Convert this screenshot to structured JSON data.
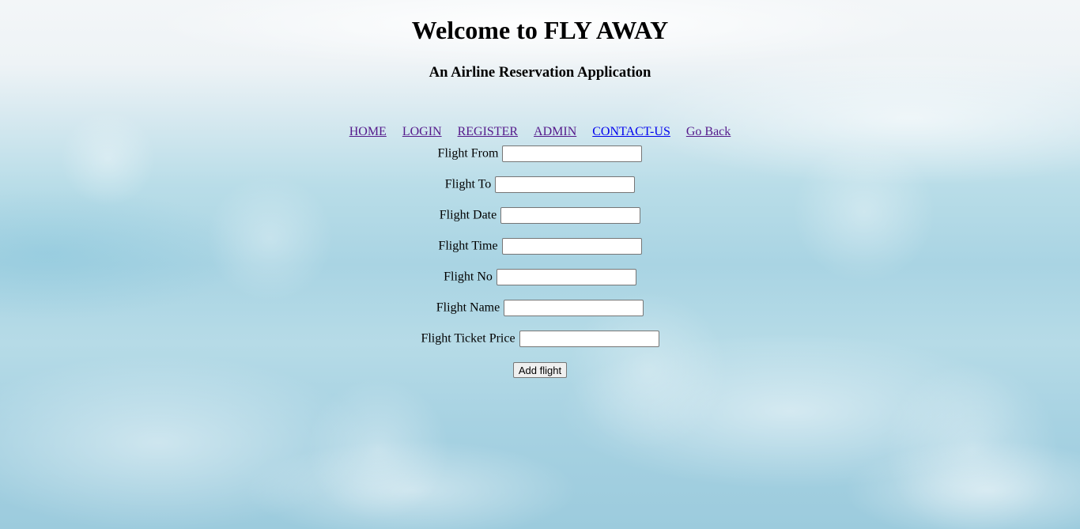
{
  "header": {
    "title": "Welcome to FLY AWAY",
    "subtitle": "An Airline Reservation Application"
  },
  "nav": {
    "items": [
      {
        "label": "HOME",
        "state": "visited"
      },
      {
        "label": "LOGIN",
        "state": "visited"
      },
      {
        "label": "REGISTER",
        "state": "visited"
      },
      {
        "label": "ADMIN",
        "state": "visited"
      },
      {
        "label": "CONTACT-US",
        "state": "unvisited"
      },
      {
        "label": "Go Back",
        "state": "visited"
      }
    ]
  },
  "form": {
    "fields": [
      {
        "label": "Flight From",
        "value": ""
      },
      {
        "label": "Flight To",
        "value": ""
      },
      {
        "label": "Flight Date",
        "value": ""
      },
      {
        "label": "Flight Time",
        "value": ""
      },
      {
        "label": "Flight No",
        "value": ""
      },
      {
        "label": "Flight Name",
        "value": ""
      },
      {
        "label": "Flight Ticket Price",
        "value": ""
      }
    ],
    "submit_label": "Add flight"
  },
  "colors": {
    "link_visited": "#551a8b",
    "link_unvisited": "#0000ee",
    "sky_top": "#f3f6f8",
    "sky_bottom": "#9ccbdd"
  }
}
